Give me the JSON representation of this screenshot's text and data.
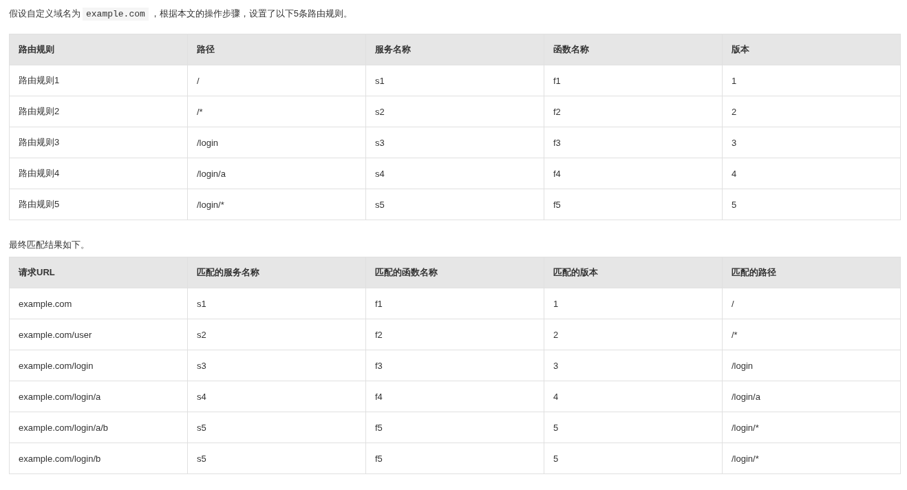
{
  "intro": {
    "before": "假设自定义域名为",
    "code": "example.com",
    "after": "，根据本文的操作步骤，设置了以下5条路由规则。"
  },
  "routes_table": {
    "columns": [
      "路由规则",
      "路径",
      "服务名称",
      "函数名称",
      "版本"
    ],
    "rows": [
      [
        "路由规则1",
        "/",
        "s1",
        "f1",
        "1"
      ],
      [
        "路由规则2",
        "/*",
        "s2",
        "f2",
        "2"
      ],
      [
        "路由规则3",
        "/login",
        "s3",
        "f3",
        "3"
      ],
      [
        "路由规则4",
        "/login/a",
        "s4",
        "f4",
        "4"
      ],
      [
        "路由规则5",
        "/login/*",
        "s5",
        "f5",
        "5"
      ]
    ]
  },
  "result_text": "最终匹配结果如下。",
  "results_table": {
    "columns": [
      "请求URL",
      "匹配的服务名称",
      "匹配的函数名称",
      "匹配的版本",
      "匹配的路径"
    ],
    "rows": [
      [
        "example.com",
        "s1",
        "f1",
        "1",
        "/"
      ],
      [
        "example.com/user",
        "s2",
        "f2",
        "2",
        "/*"
      ],
      [
        "example.com/login",
        "s3",
        "f3",
        "3",
        "/login"
      ],
      [
        "example.com/login/a",
        "s4",
        "f4",
        "4",
        "/login/a"
      ],
      [
        "example.com/login/a/b",
        "s5",
        "f5",
        "5",
        "/login/*"
      ],
      [
        "example.com/login/b",
        "s5",
        "f5",
        "5",
        "/login/*"
      ]
    ]
  }
}
